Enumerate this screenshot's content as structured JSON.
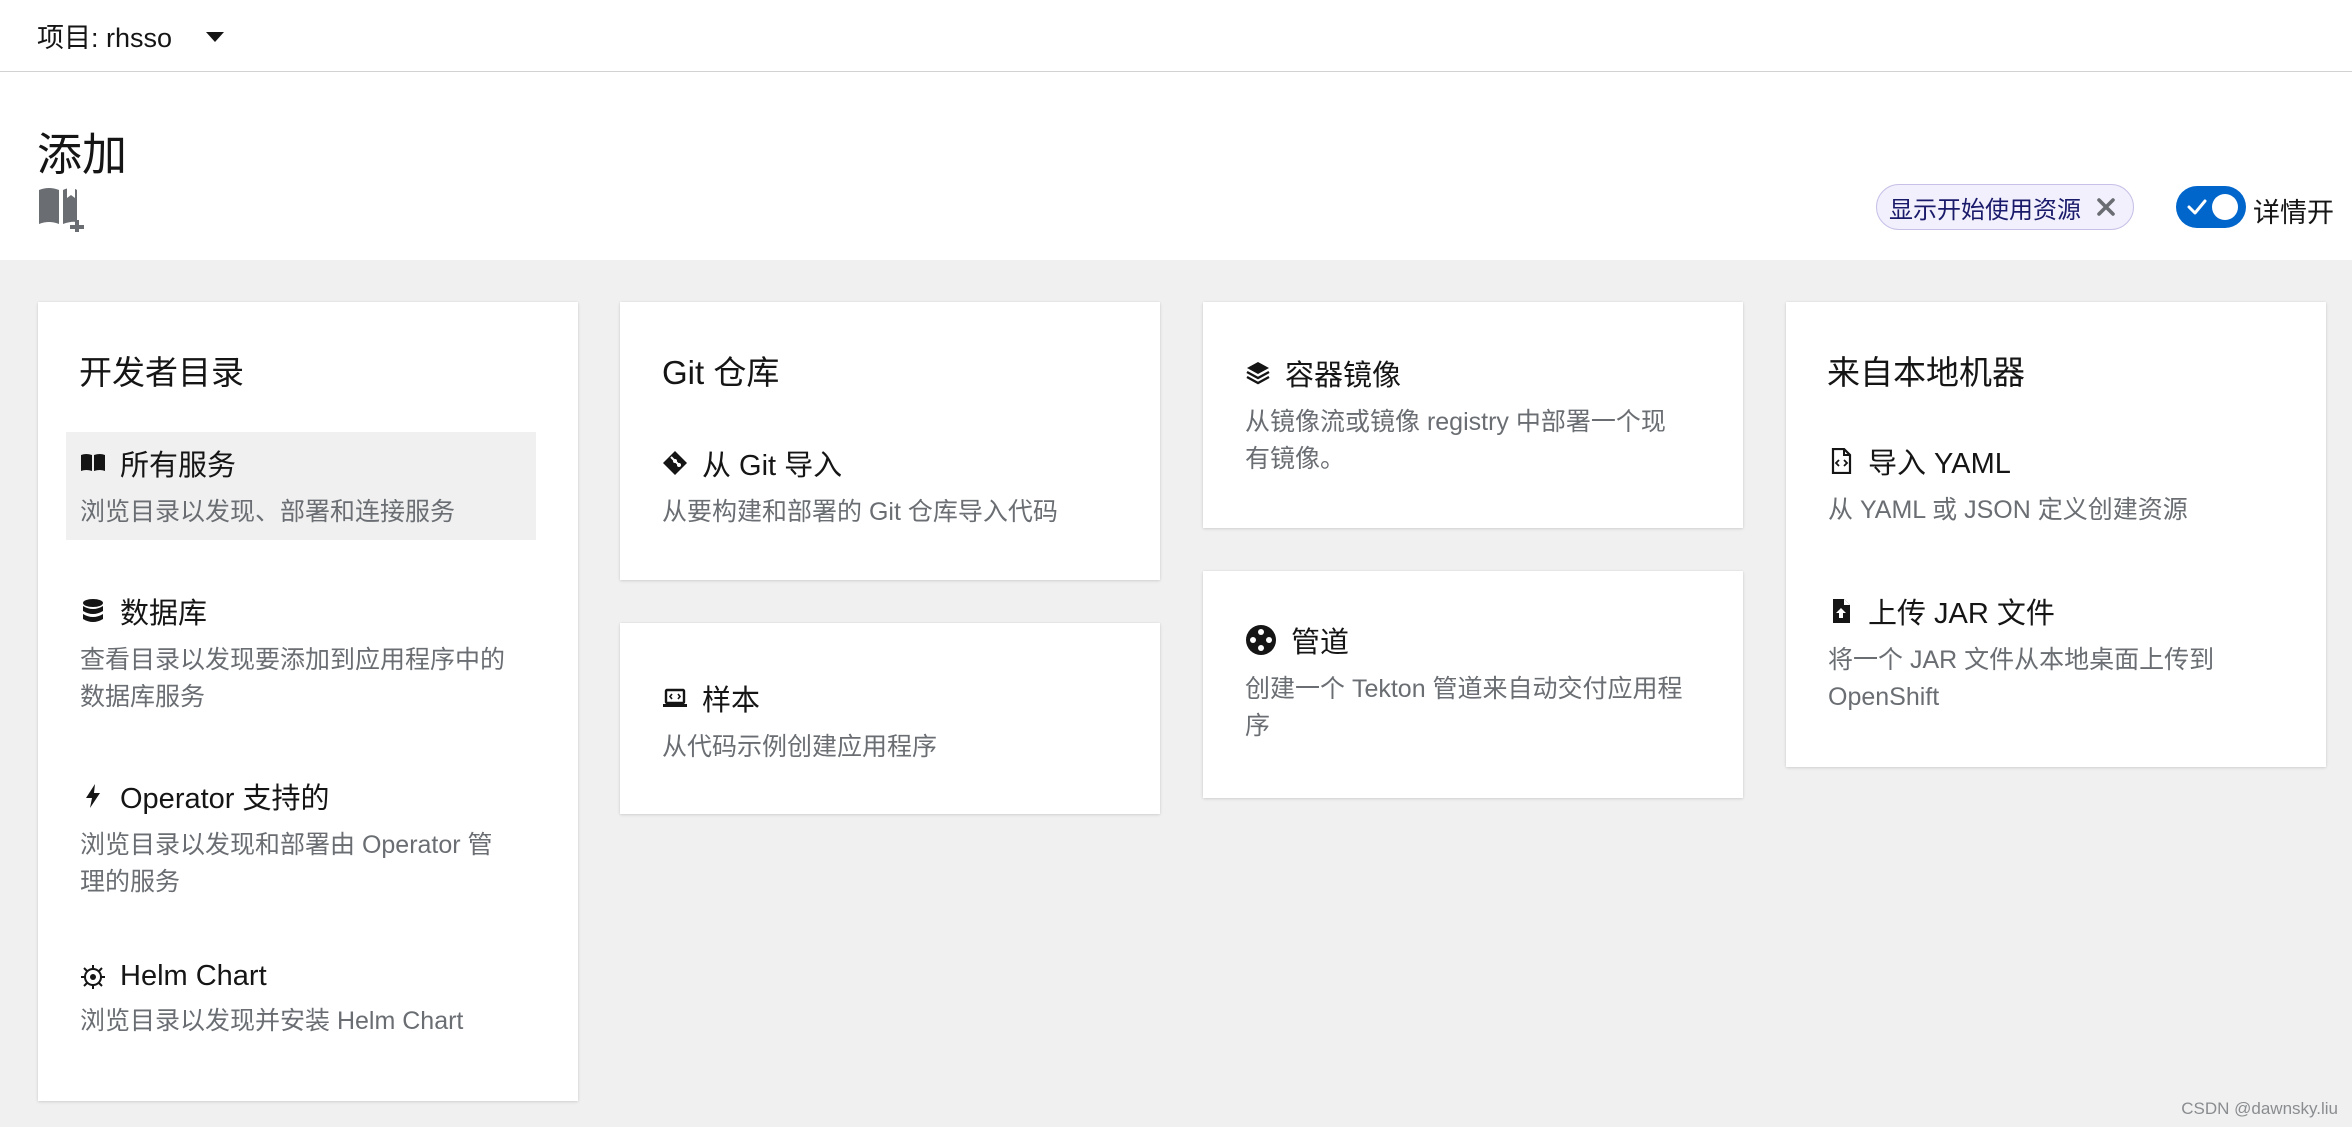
{
  "topbar": {
    "project_label": "项目: rhsso"
  },
  "header": {
    "title": "添加",
    "chip_label": "显示开始使用资源",
    "toggle_label": "详情开"
  },
  "cards": {
    "developer_catalog": {
      "title": "开发者目录",
      "items": [
        {
          "title": "所有服务",
          "desc": "浏览目录以发现、部署和连接服务",
          "icon": "book-open-icon"
        },
        {
          "title": "数据库",
          "desc": "查看目录以发现要添加到应用程序中的数据库服务",
          "icon": "database-icon"
        },
        {
          "title": "Operator 支持的",
          "desc": "浏览目录以发现和部署由 Operator 管理的服务",
          "icon": "bolt-icon"
        },
        {
          "title": "Helm Chart",
          "desc": "浏览目录以发现并安装 Helm Chart",
          "icon": "helm-icon"
        }
      ]
    },
    "git": {
      "title": "Git 仓库",
      "items": [
        {
          "title": "从 Git 导入",
          "desc": "从要构建和部署的 Git 仓库导入代码",
          "icon": "git-icon"
        }
      ]
    },
    "samples": {
      "items": [
        {
          "title": "样本",
          "desc": "从代码示例创建应用程序",
          "icon": "laptop-code-icon"
        }
      ]
    },
    "container_image": {
      "items": [
        {
          "title": "容器镜像",
          "desc": "从镜像流或镜像 registry 中部署一个现有镜像。",
          "icon": "cube-layers-icon"
        }
      ]
    },
    "pipelines": {
      "items": [
        {
          "title": "管道",
          "desc": "创建一个 Tekton 管道来自动交付应用程序",
          "icon": "pipeline-icon"
        }
      ]
    },
    "local_machine": {
      "title": "来自本地机器",
      "items": [
        {
          "title": "导入 YAML",
          "desc": "从 YAML 或 JSON 定义创建资源",
          "icon": "file-code-icon"
        },
        {
          "title": "上传 JAR 文件",
          "desc": "将一个 JAR 文件从本地桌面上传到 OpenShift",
          "icon": "file-upload-icon"
        }
      ]
    }
  },
  "watermark": "CSDN @dawnsky.liu",
  "colors": {
    "accent": "#0066cc",
    "chip_bg": "#f2f0fc",
    "page_bg": "#f0f0f0",
    "desc_text": "#6a6e73"
  }
}
